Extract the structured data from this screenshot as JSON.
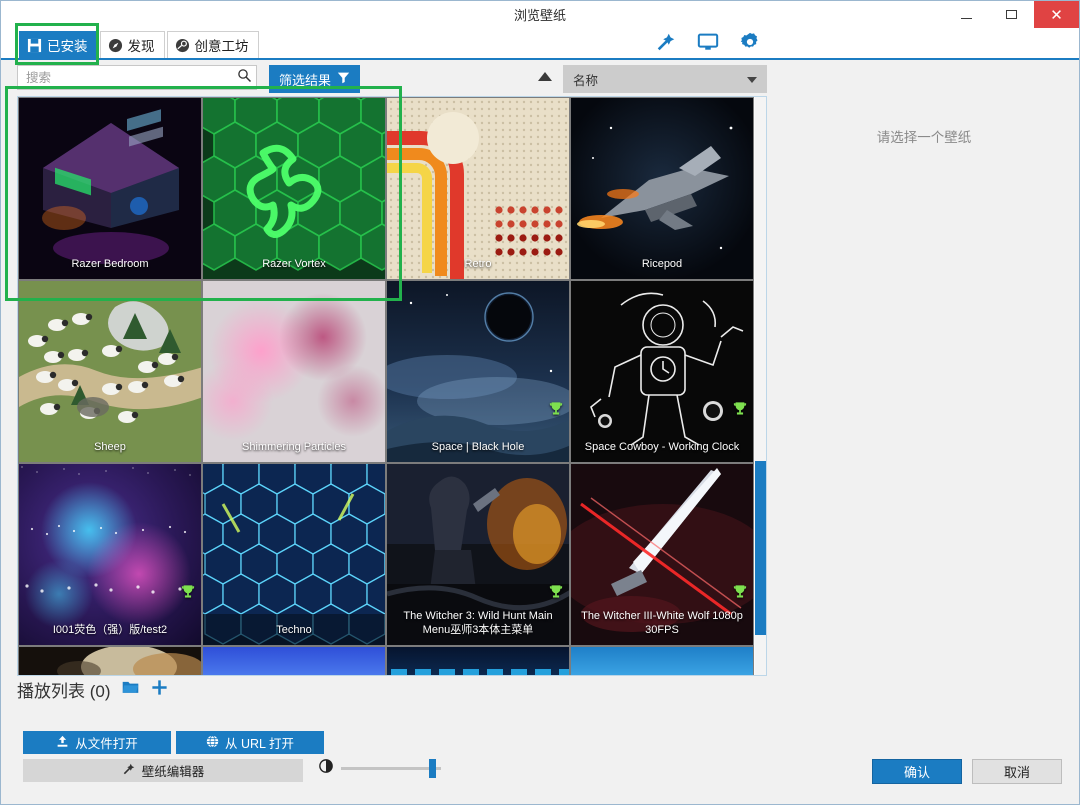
{
  "window": {
    "title": "浏览壁纸",
    "minimize_label": "—",
    "maximize_label": "▢",
    "close_label": "✕"
  },
  "tabs": [
    {
      "label": "已安装",
      "icon": "save-disk-icon",
      "active": true
    },
    {
      "label": "发现",
      "icon": "compass-icon",
      "active": false
    },
    {
      "label": "创意工坊",
      "icon": "steam-workshop-icon",
      "active": false
    }
  ],
  "toolbar_icons": [
    {
      "name": "wand-edit-icon"
    },
    {
      "name": "monitor-icon"
    },
    {
      "name": "gear-icon"
    }
  ],
  "search": {
    "value": "",
    "placeholder": "搜索",
    "icon": "search-icon"
  },
  "filter": {
    "label": "筛选结果",
    "icon": "funnel-icon"
  },
  "sort": {
    "direction_icon": "sort-ascending-arrow",
    "selected": "名称",
    "options": [
      "名称"
    ]
  },
  "right_panel": {
    "hint": "请选择一个壁纸"
  },
  "scrollbar": {
    "thumb_top_pct": 63,
    "thumb_height_pct": 30
  },
  "wallpapers": [
    {
      "label": "Razer Bedroom",
      "badge": false,
      "art": "razer-bedroom"
    },
    {
      "label": "Razer Vortex",
      "badge": false,
      "art": "razer-vortex"
    },
    {
      "label": "Retro",
      "badge": false,
      "art": "retro"
    },
    {
      "label": "Ricepod",
      "badge": false,
      "art": "ricepod"
    },
    {
      "label": "Sheep",
      "badge": false,
      "art": "sheep"
    },
    {
      "label": "Shimmering Particles",
      "badge": false,
      "art": "shimmering"
    },
    {
      "label": "Space | Black Hole",
      "badge": true,
      "art": "blackhole"
    },
    {
      "label": "Space Cowboy - Working Clock",
      "badge": true,
      "art": "spacecowboy"
    },
    {
      "label": "I001荧色（强）版/test2",
      "badge": true,
      "art": "nebula"
    },
    {
      "label": "Techno",
      "badge": false,
      "art": "techno"
    },
    {
      "label": "The Witcher 3: Wild Hunt Main Menu巫师3本体主菜单",
      "badge": true,
      "art": "witcher3"
    },
    {
      "label": "The Witcher III-White Wolf 1080p 30FPS",
      "badge": true,
      "art": "witcherwolf"
    }
  ],
  "partial_row": [
    {
      "art": "flare"
    },
    {
      "art": "bluegrad"
    },
    {
      "art": "darkblue"
    },
    {
      "art": "skyblue"
    }
  ],
  "playlist": {
    "title": "播放列表 (0)",
    "folder_icon": "folder-open-icon",
    "add_icon": "plus-icon"
  },
  "actions": {
    "open_file": "从文件打开",
    "open_file_icon": "upload-icon",
    "open_url": "从 URL 打开",
    "open_url_icon": "globe-icon",
    "wallpaper_editor": "壁纸编辑器",
    "wallpaper_editor_icon": "wand-edit-icon"
  },
  "slider": {
    "icon": "contrast-icon",
    "value_pct": 92
  },
  "footer": {
    "confirm": "确认",
    "cancel": "取消"
  },
  "colors": {
    "accent": "#1b7cc2",
    "annotation": "#22b14c",
    "close": "#e04343"
  }
}
